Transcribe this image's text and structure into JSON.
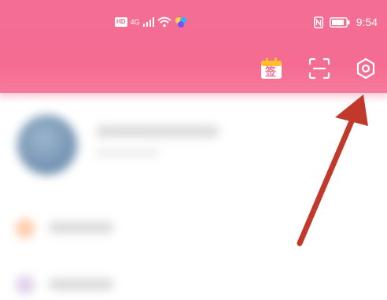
{
  "status_bar": {
    "hd": "HD",
    "network": "4G",
    "time": "9:54",
    "nfc": "N"
  },
  "toolbar": {
    "checkin_label": "签",
    "icons": [
      "calendar-checkin-icon",
      "scan-icon",
      "settings-icon"
    ]
  },
  "colors": {
    "header": "#f46e94",
    "arrow": "#c0392b"
  }
}
